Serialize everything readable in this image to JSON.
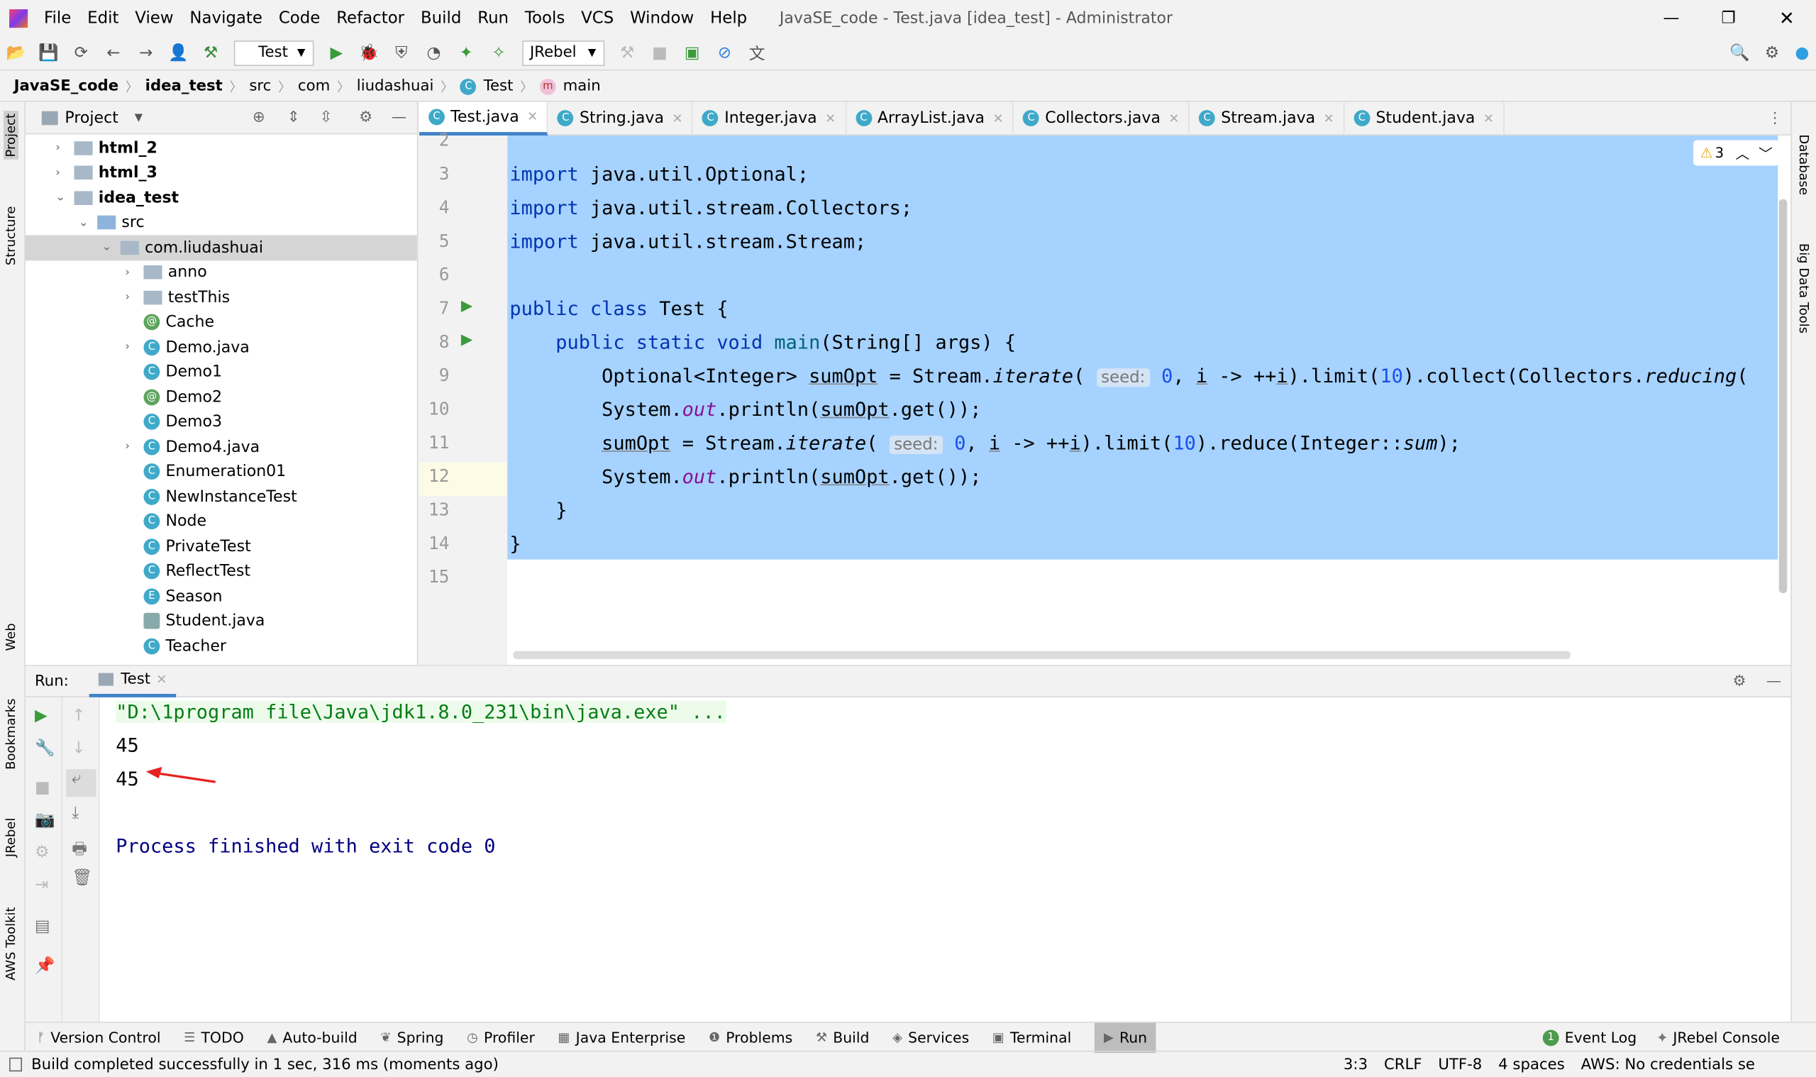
{
  "window": {
    "title": "JavaSE_code - Test.java [idea_test] - Administrator",
    "menu": [
      "File",
      "Edit",
      "View",
      "Navigate",
      "Code",
      "Refactor",
      "Build",
      "Run",
      "Tools",
      "VCS",
      "Window",
      "Help"
    ]
  },
  "toolbar": {
    "run_config": "Test",
    "jrebel": "JRebel"
  },
  "breadcrumb": [
    "JavaSE_code",
    "idea_test",
    "src",
    "com",
    "liudashuai",
    "Test",
    "main"
  ],
  "left_stripe": [
    "Project",
    "Structure",
    "Web",
    "Bookmarks",
    "JRebel",
    "AWS Toolkit"
  ],
  "right_stripe": [
    "Database",
    "Big Data Tools"
  ],
  "project": {
    "title": "Project",
    "tree": [
      {
        "label": "html_2",
        "type": "module",
        "depth": 0,
        "arrow": "right"
      },
      {
        "label": "html_3",
        "type": "module",
        "depth": 0,
        "arrow": "right"
      },
      {
        "label": "idea_test",
        "type": "module",
        "depth": 0,
        "arrow": "down"
      },
      {
        "label": "src",
        "type": "folder",
        "depth": 1,
        "arrow": "down"
      },
      {
        "label": "com.liudashuai",
        "type": "package",
        "depth": 2,
        "arrow": "down",
        "selected": true
      },
      {
        "label": "anno",
        "type": "package",
        "depth": 3,
        "arrow": "right"
      },
      {
        "label": "testThis",
        "type": "package",
        "depth": 3,
        "arrow": "right"
      },
      {
        "label": "Cache",
        "type": "annotation",
        "depth": 3
      },
      {
        "label": "Demo.java",
        "type": "java",
        "depth": 3,
        "arrow": "right"
      },
      {
        "label": "Demo1",
        "type": "class",
        "depth": 3
      },
      {
        "label": "Demo2",
        "type": "annotation",
        "depth": 3
      },
      {
        "label": "Demo3",
        "type": "class",
        "depth": 3
      },
      {
        "label": "Demo4.java",
        "type": "java",
        "depth": 3,
        "arrow": "right"
      },
      {
        "label": "Enumeration01",
        "type": "class",
        "depth": 3
      },
      {
        "label": "NewInstanceTest",
        "type": "class",
        "depth": 3
      },
      {
        "label": "Node",
        "type": "class",
        "depth": 3
      },
      {
        "label": "PrivateTest",
        "type": "class",
        "depth": 3
      },
      {
        "label": "ReflectTest",
        "type": "class",
        "depth": 3
      },
      {
        "label": "Season",
        "type": "enum",
        "depth": 3
      },
      {
        "label": "Student.java",
        "type": "file",
        "depth": 3
      },
      {
        "label": "Teacher",
        "type": "class",
        "depth": 3
      }
    ]
  },
  "tabs": [
    {
      "label": "Test.java",
      "active": true
    },
    {
      "label": "String.java"
    },
    {
      "label": "Integer.java"
    },
    {
      "label": "ArrayList.java"
    },
    {
      "label": "Collectors.java"
    },
    {
      "label": "Stream.java"
    },
    {
      "label": "Student.java"
    }
  ],
  "editor": {
    "warnings": "3",
    "line_numbers": [
      "2",
      "3",
      "4",
      "5",
      "6",
      "7",
      "8",
      "9",
      "10",
      "11",
      "12",
      "13",
      "14",
      "15"
    ],
    "lines": [
      [],
      [
        {
          "t": "import ",
          "c": "kw"
        },
        {
          "t": "java.util.Optional;"
        }
      ],
      [
        {
          "t": "import ",
          "c": "kw"
        },
        {
          "t": "java.util.stream.Collectors;"
        }
      ],
      [
        {
          "t": "import ",
          "c": "kw"
        },
        {
          "t": "java.util.stream.Stream;"
        }
      ],
      [],
      [
        {
          "t": "public class ",
          "c": "kw"
        },
        {
          "t": "Test {"
        }
      ],
      [
        {
          "t": "    public static void ",
          "c": "kw"
        },
        {
          "t": "main",
          "c": "fn"
        },
        {
          "t": "(String[] args) {"
        }
      ],
      [
        {
          "t": "        Optional<Integer> "
        },
        {
          "t": "sumOpt",
          "c": "ul"
        },
        {
          "t": " = Stream."
        },
        {
          "t": "iterate",
          "c": "it"
        },
        {
          "t": "( "
        },
        {
          "t": "seed:",
          "c": "hint"
        },
        {
          "t": " 0",
          "c": "num"
        },
        {
          "t": ", "
        },
        {
          "t": "i",
          "c": "ul"
        },
        {
          "t": " -> ++"
        },
        {
          "t": "i",
          "c": "ul"
        },
        {
          "t": ").limit("
        },
        {
          "t": "10",
          "c": "num"
        },
        {
          "t": ").collect(Collectors."
        },
        {
          "t": "reducing",
          "c": "it"
        },
        {
          "t": "("
        }
      ],
      [
        {
          "t": "        System."
        },
        {
          "t": "out",
          "c": "st"
        },
        {
          "t": ".println("
        },
        {
          "t": "sumOpt",
          "c": "ul"
        },
        {
          "t": ".get());"
        }
      ],
      [
        {
          "t": "        "
        },
        {
          "t": "sumOpt",
          "c": "ul"
        },
        {
          "t": " = Stream."
        },
        {
          "t": "iterate",
          "c": "it"
        },
        {
          "t": "( "
        },
        {
          "t": "seed:",
          "c": "hint"
        },
        {
          "t": " 0",
          "c": "num"
        },
        {
          "t": ", "
        },
        {
          "t": "i",
          "c": "ul"
        },
        {
          "t": " -> ++"
        },
        {
          "t": "i",
          "c": "ul"
        },
        {
          "t": ").limit("
        },
        {
          "t": "10",
          "c": "num"
        },
        {
          "t": ").reduce(Integer::"
        },
        {
          "t": "sum",
          "c": "it"
        },
        {
          "t": ");"
        }
      ],
      [
        {
          "t": "        System."
        },
        {
          "t": "out",
          "c": "st"
        },
        {
          "t": ".println("
        },
        {
          "t": "sumOpt",
          "c": "ul"
        },
        {
          "t": ".get());"
        }
      ],
      [
        {
          "t": "    }"
        }
      ],
      [
        {
          "t": "}"
        }
      ],
      []
    ]
  },
  "run": {
    "label": "Run:",
    "tab": "Test",
    "output": [
      "\"D:\\1program file\\Java\\jdk1.8.0_231\\bin\\java.exe\" ...",
      "45",
      "45",
      "",
      "Process finished with exit code 0"
    ]
  },
  "bottom_tools": [
    "Version Control",
    "TODO",
    "Auto-build",
    "Spring",
    "Profiler",
    "Java Enterprise",
    "Problems",
    "Build",
    "Services",
    "Terminal",
    "Run"
  ],
  "bottom_right": [
    "Event Log",
    "JRebel Console"
  ],
  "event_count": "1",
  "status": {
    "message": "Build completed successfully in 1 sec, 316 ms (moments ago)",
    "position": "3:3",
    "line_sep": "CRLF",
    "encoding": "UTF-8",
    "indent": "4 spaces",
    "aws": "AWS: No credentials se"
  }
}
